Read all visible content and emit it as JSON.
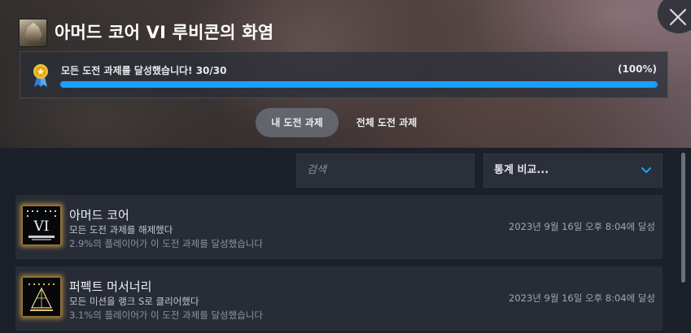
{
  "game": {
    "title": "아머드 코어 VI 루비콘의 화염",
    "icon": "game-cover-icon"
  },
  "progress": {
    "message": "모든 도전 과제를 달성했습니다! 30/30",
    "percent_label": "(100%)",
    "fraction": 1.0,
    "icon": "medal-icon",
    "bar_color": "#1a9fff"
  },
  "tabs": {
    "mine": "내 도전 과제",
    "all": "전체 도전 과제"
  },
  "toolbar": {
    "search_placeholder": "검색",
    "compare_label": "통계 비교..."
  },
  "achievements": [
    {
      "name": "아머드 코어",
      "description": "모든 도전 과제를 해제했다",
      "rarity": "2.9%의 플레이어가 이 도전 과제를 달성했습니다",
      "unlocked": "2023년 9월 16일 오후 8:04에 달성",
      "icon_text": "VI"
    },
    {
      "name": "퍼펙트 머서너리",
      "description": "모든 미션을 랭크 S로 클리어했다",
      "rarity": "3.1%의 플레이어가 이 도전 과제를 달성했습니다",
      "unlocked": "2023년 9월 16일 오후 8:04에 달성"
    }
  ],
  "colors": {
    "accent": "#1a9fff",
    "row_bg": "#272c36",
    "icon_glow": "#e6aa3c"
  }
}
